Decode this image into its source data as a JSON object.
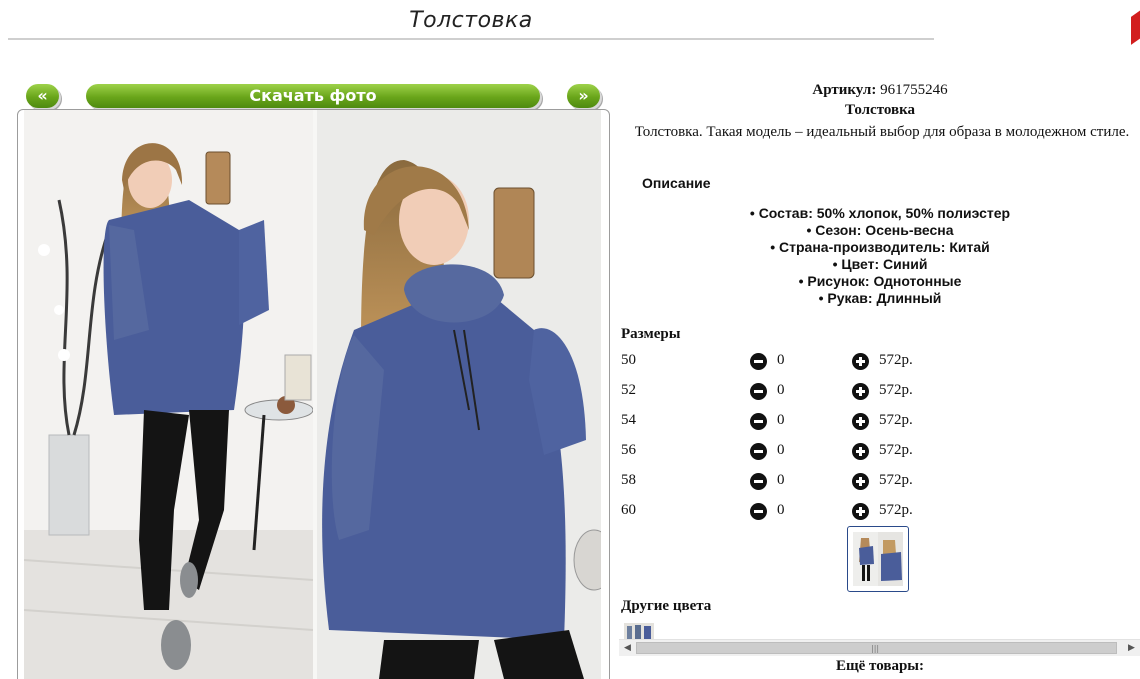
{
  "page": {
    "title": "Толстовка"
  },
  "nav": {
    "prev_label": "«",
    "download_label": "Скачать фото",
    "next_label": "»"
  },
  "product": {
    "sku_label": "Артикул:",
    "sku_value": "961755246",
    "name": "Толстовка",
    "description": "Толстовка. Такая модель – идеальный выбор для образа в молодежном стиле.",
    "description_heading": "Описание",
    "features": [
      "Состав: 50% хлопок, 50% полиэстер",
      "Сезон: Осень-весна",
      "Страна-производитель: Китай",
      "Цвет: Синий",
      "Рисунок: Однотонные",
      "Рукав: Длинный"
    ]
  },
  "sizes": {
    "heading": "Размеры",
    "rows": [
      {
        "size": "50",
        "qty": "0",
        "price": "572р."
      },
      {
        "size": "52",
        "qty": "0",
        "price": "572р."
      },
      {
        "size": "54",
        "qty": "0",
        "price": "572р."
      },
      {
        "size": "56",
        "qty": "0",
        "price": "572р."
      },
      {
        "size": "58",
        "qty": "0",
        "price": "572р."
      },
      {
        "size": "60",
        "qty": "0",
        "price": "572р."
      }
    ]
  },
  "other_colors": {
    "heading": "Другие цвета"
  },
  "more_products": {
    "heading": "Ещё товары:"
  },
  "icons": {
    "minus": "minus-circle-icon",
    "plus": "plus-circle-icon"
  },
  "colors": {
    "button_green": "#69a51a",
    "sweater_blue": "#4a5d9a",
    "accent_red": "#d21e1e"
  }
}
